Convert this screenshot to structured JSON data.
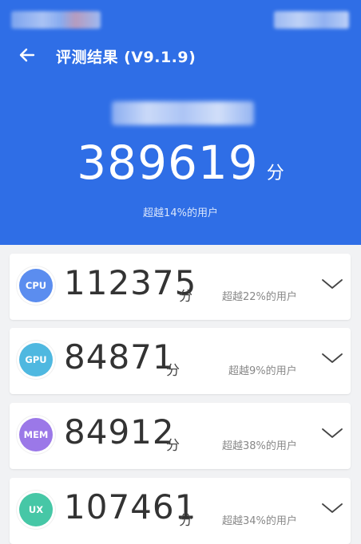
{
  "header": {
    "title": "评测结果 (V9.1.9)",
    "total_score": "389619",
    "unit": "分",
    "percentile": "超越14%的用户"
  },
  "colors": {
    "header_bg": "#2f6ee6",
    "cpu_badge": "#5b8def",
    "gpu_badge": "#4fb8e0",
    "mem_badge": "#9b78e8",
    "ux_badge": "#46c7a6"
  },
  "cards": [
    {
      "badge": "CPU",
      "score": "112375",
      "unit": "分",
      "percentile": "超越22%的用户"
    },
    {
      "badge": "GPU",
      "score": "84871",
      "unit": "分",
      "percentile": "超越9%的用户"
    },
    {
      "badge": "MEM",
      "score": "84912",
      "unit": "分",
      "percentile": "超越38%的用户"
    },
    {
      "badge": "UX",
      "score": "107461",
      "unit": "分",
      "percentile": "超越34%的用户"
    }
  ],
  "icons": {
    "back": "arrow-left-icon",
    "expand": "chevron-down-icon"
  }
}
